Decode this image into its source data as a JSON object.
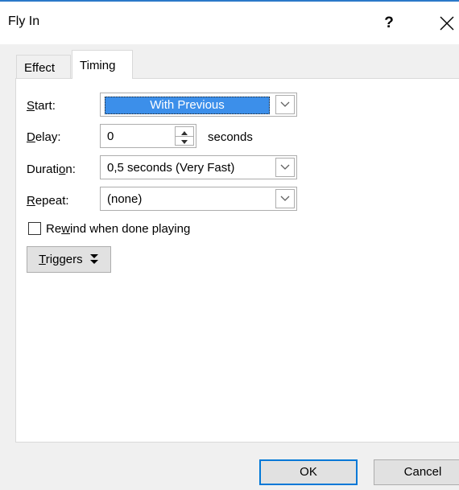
{
  "window": {
    "title": "Fly In",
    "help_label": "?",
    "close_icon": "close-icon"
  },
  "tabs": [
    {
      "label": "Effect",
      "selected": false
    },
    {
      "label": "Timing",
      "selected": true
    }
  ],
  "timing": {
    "start_label": "Start:",
    "start_value": "With Previous",
    "delay_label": "Delay:",
    "delay_value": "0",
    "delay_unit": "seconds",
    "duration_label": "Duration:",
    "duration_value": "0,5 seconds (Very Fast)",
    "repeat_label": "Repeat:",
    "repeat_value": "(none)",
    "rewind_label": "Rewind when done playing",
    "rewind_checked": false,
    "triggers_label": "Triggers"
  },
  "footer": {
    "ok_label": "OK",
    "cancel_label": "Cancel"
  },
  "colors": {
    "accent": "#2b79c9",
    "selection": "#3c8fea",
    "default_button_border": "#0078d7"
  }
}
